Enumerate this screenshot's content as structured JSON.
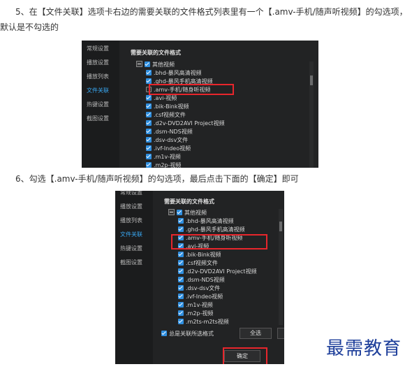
{
  "step5_text": "5、在【文件关联】选项卡右边的需要关联的文件格式列表里有一个【.amv-手机/随声听视频】的勾选项，默认是不勾选的",
  "step6_text": "6、勾选【.amv-手机/随声听视频】的勾选项，最后点击下面的【确定】即可",
  "sidebar": [
    "常规设置",
    "播放设置",
    "播放列表",
    "文件关联",
    "热键设置",
    "截图设置"
  ],
  "active_sidebar": "文件关联",
  "panel_heading": "需要关联的文件格式",
  "group_label": "其他视频",
  "shot1_items": [
    {
      "label": ".bhd-暴风高清视频",
      "checked": true
    },
    {
      "label": ".ghd-暴风手机高清视频",
      "checked": true
    },
    {
      "label": ".amv-手机/随身听视频",
      "checked": false
    },
    {
      "label": ".avi-视频",
      "checked": true
    },
    {
      "label": ".bik-Bink视频",
      "checked": true
    },
    {
      "label": ".csf视频文件",
      "checked": true
    },
    {
      "label": ".d2v-DVD2AVI Project视频",
      "checked": true
    },
    {
      "label": ".dsm-NDS视频",
      "checked": true
    },
    {
      "label": ".dsv-dsv文件",
      "checked": true
    },
    {
      "label": ".ivf-Indeo视频",
      "checked": true
    },
    {
      "label": ".m1v-视频",
      "checked": true
    },
    {
      "label": ".m2p-视频",
      "checked": true
    }
  ],
  "shot2_items": [
    {
      "label": ".bhd-暴风高清视频",
      "checked": true
    },
    {
      "label": ".ghd-暴风手机高清视频",
      "checked": true
    },
    {
      "label": ".amv-手机/随身听视频",
      "checked": true
    },
    {
      "label": ".avi-视频",
      "checked": true
    },
    {
      "label": ".bik-Bink视频",
      "checked": true
    },
    {
      "label": ".csf视频文件",
      "checked": true
    },
    {
      "label": ".d2v-DVD2AVI Project视频",
      "checked": true
    },
    {
      "label": ".dsm-NDS视频",
      "checked": true
    },
    {
      "label": ".dsv-dsv文件",
      "checked": true
    },
    {
      "label": ".ivf-Indeo视频",
      "checked": true
    },
    {
      "label": ".m1v-视频",
      "checked": true
    },
    {
      "label": ".m2p-视频",
      "checked": true
    },
    {
      "label": ".m2ts-m2ts视频",
      "checked": true
    }
  ],
  "footer_checkbox_label": "总是关联所选格式",
  "select_all_label": "全选",
  "confirm_label": "确定",
  "watermark": "最需教育",
  "colors": {
    "highlight": "#e8262c",
    "checkbox": "#2f8fe0",
    "active_tab": "#39a8f2",
    "watermark": "#1d3e9a"
  }
}
